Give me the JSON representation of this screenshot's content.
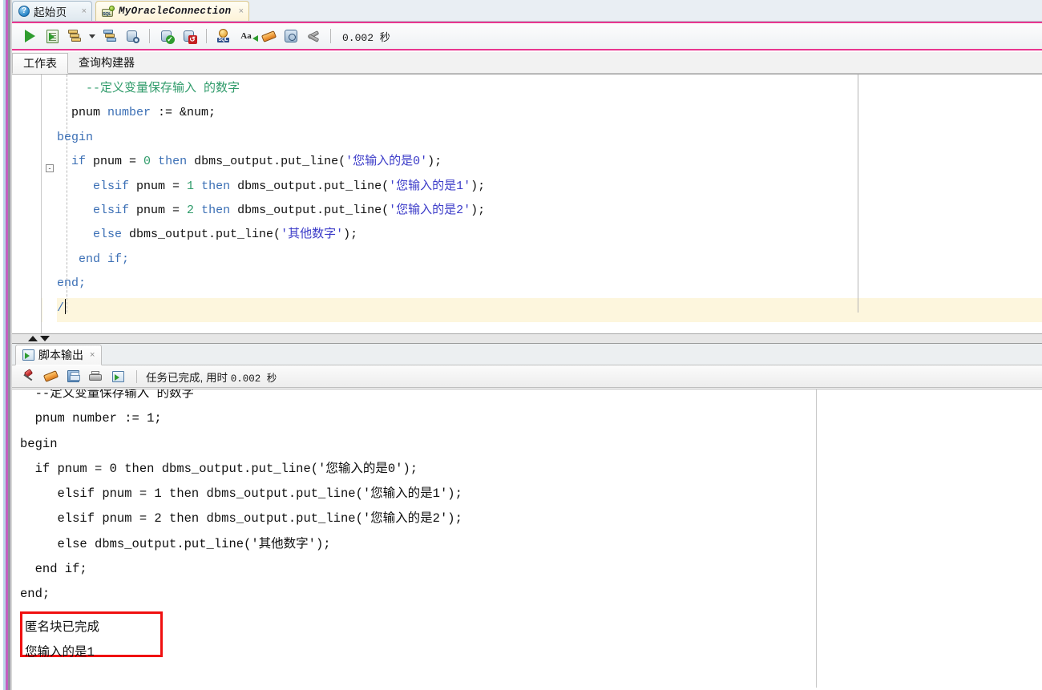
{
  "window": {
    "tabs": [
      {
        "label": "起始页",
        "icon": "help-icon",
        "active": false,
        "close": "×"
      },
      {
        "label": "MyOracleConnection",
        "icon": "sql-connection-icon",
        "active": true,
        "close": "×"
      }
    ]
  },
  "toolbar": {
    "buttons": [
      {
        "name": "run-statement-button",
        "icon": "play-icon",
        "tooltip": "执行语句"
      },
      {
        "name": "run-script-button",
        "icon": "run-script-icon",
        "tooltip": "运行脚本"
      },
      {
        "name": "explain-plan-button",
        "icon": "explain-plan-icon",
        "tooltip": "自动跟踪"
      },
      {
        "name": "explain-plan-dropdown",
        "icon": "chevron-down-icon",
        "tooltip": ""
      },
      {
        "name": "autotrace-button",
        "icon": "autotrace-icon",
        "tooltip": "自动跟踪"
      },
      {
        "name": "sql-history-button",
        "icon": "db-search-icon",
        "tooltip": "查询"
      },
      {
        "name": "commit-button",
        "icon": "commit-icon",
        "tooltip": "提交"
      },
      {
        "name": "rollback-button",
        "icon": "rollback-icon",
        "tooltip": "回退"
      },
      {
        "name": "unshared-sql-button",
        "icon": "sql-gear-icon",
        "tooltip": "取消共享SQL工作表"
      },
      {
        "name": "to-upper-case-button",
        "icon": "font-case-icon",
        "tooltip": "更改大小写"
      },
      {
        "name": "clear-button",
        "icon": "eraser-icon",
        "tooltip": "清除"
      },
      {
        "name": "sql-history-clock-button",
        "icon": "clock-history-icon",
        "tooltip": "SQL历史记录"
      },
      {
        "name": "tools-button",
        "icon": "wrench-icon",
        "tooltip": "工具"
      }
    ],
    "elapsed": "0.002 秒"
  },
  "subtabs": [
    {
      "label": "工作表",
      "selected": true
    },
    {
      "label": "查询构建器",
      "selected": false
    }
  ],
  "editor": {
    "lines": [
      {
        "indent": 4,
        "segments": [
          {
            "t": "--定义变量保存输入 的数字",
            "c": "cm"
          }
        ]
      },
      {
        "indent": 2,
        "segments": [
          {
            "t": "pnum ",
            "c": ""
          },
          {
            "t": "number",
            "c": "kw"
          },
          {
            "t": " := &num;",
            "c": ""
          }
        ]
      },
      {
        "indent": 0,
        "segments": [
          {
            "t": "begin",
            "c": "kw"
          }
        ]
      },
      {
        "indent": 2,
        "segments": [
          {
            "t": "if",
            "c": "kw"
          },
          {
            "t": " pnum = ",
            "c": ""
          },
          {
            "t": "0",
            "c": "num"
          },
          {
            "t": " ",
            "c": ""
          },
          {
            "t": "then",
            "c": "kw"
          },
          {
            "t": " dbms_output.put_line(",
            "c": ""
          },
          {
            "t": "'您输入的是0'",
            "c": "str"
          },
          {
            "t": ");",
            "c": ""
          }
        ]
      },
      {
        "indent": 5,
        "segments": [
          {
            "t": "elsif",
            "c": "kw"
          },
          {
            "t": " pnum = ",
            "c": ""
          },
          {
            "t": "1",
            "c": "num"
          },
          {
            "t": " ",
            "c": ""
          },
          {
            "t": "then",
            "c": "kw"
          },
          {
            "t": " dbms_output.put_line(",
            "c": ""
          },
          {
            "t": "'您输入的是1'",
            "c": "str"
          },
          {
            "t": ");",
            "c": ""
          }
        ]
      },
      {
        "indent": 5,
        "segments": [
          {
            "t": "elsif",
            "c": "kw"
          },
          {
            "t": " pnum = ",
            "c": ""
          },
          {
            "t": "2",
            "c": "num"
          },
          {
            "t": " ",
            "c": ""
          },
          {
            "t": "then",
            "c": "kw"
          },
          {
            "t": " dbms_output.put_line(",
            "c": ""
          },
          {
            "t": "'您输入的是2'",
            "c": "str"
          },
          {
            "t": ");",
            "c": ""
          }
        ]
      },
      {
        "indent": 5,
        "segments": [
          {
            "t": "else",
            "c": "kw"
          },
          {
            "t": " dbms_output.put_line(",
            "c": ""
          },
          {
            "t": "'其他数字'",
            "c": "str"
          },
          {
            "t": ");",
            "c": ""
          }
        ]
      },
      {
        "indent": 3,
        "segments": [
          {
            "t": "end if;",
            "c": "kw"
          }
        ]
      },
      {
        "indent": 0,
        "segments": [
          {
            "t": "end;",
            "c": "kw"
          }
        ]
      },
      {
        "indent": 0,
        "segments": [
          {
            "t": "/",
            "c": "kw"
          }
        ],
        "current": true
      }
    ],
    "fold_marker": "-"
  },
  "output": {
    "tab": {
      "label": "脚本输出",
      "icon": "script-output-icon",
      "close": "×"
    },
    "toolbar": {
      "buttons": [
        {
          "name": "pin-output-button",
          "icon": "pin-icon"
        },
        {
          "name": "clear-output-button",
          "icon": "eraser-icon"
        },
        {
          "name": "save-output-button",
          "icon": "save-icon"
        },
        {
          "name": "print-output-button",
          "icon": "print-icon"
        },
        {
          "name": "open-in-editor-button",
          "icon": "script-output-icon"
        }
      ],
      "status": "任务已完成, 用时 ",
      "status_time": "0.002 秒"
    },
    "lines": [
      "  --定义变量保存输入 的数字",
      "  pnum number := 1;",
      "begin",
      "  if pnum = 0 then dbms_output.put_line('您输入的是0');",
      "     elsif pnum = 1 then dbms_output.put_line('您输入的是1');",
      "     elsif pnum = 2 then dbms_output.put_line('您输入的是2');",
      "     else dbms_output.put_line('其他数字');",
      "  end if;",
      "end;"
    ],
    "result_lines": [
      "匿名块已完成",
      "您输入的是1"
    ],
    "highlight_color": "#f01010"
  }
}
